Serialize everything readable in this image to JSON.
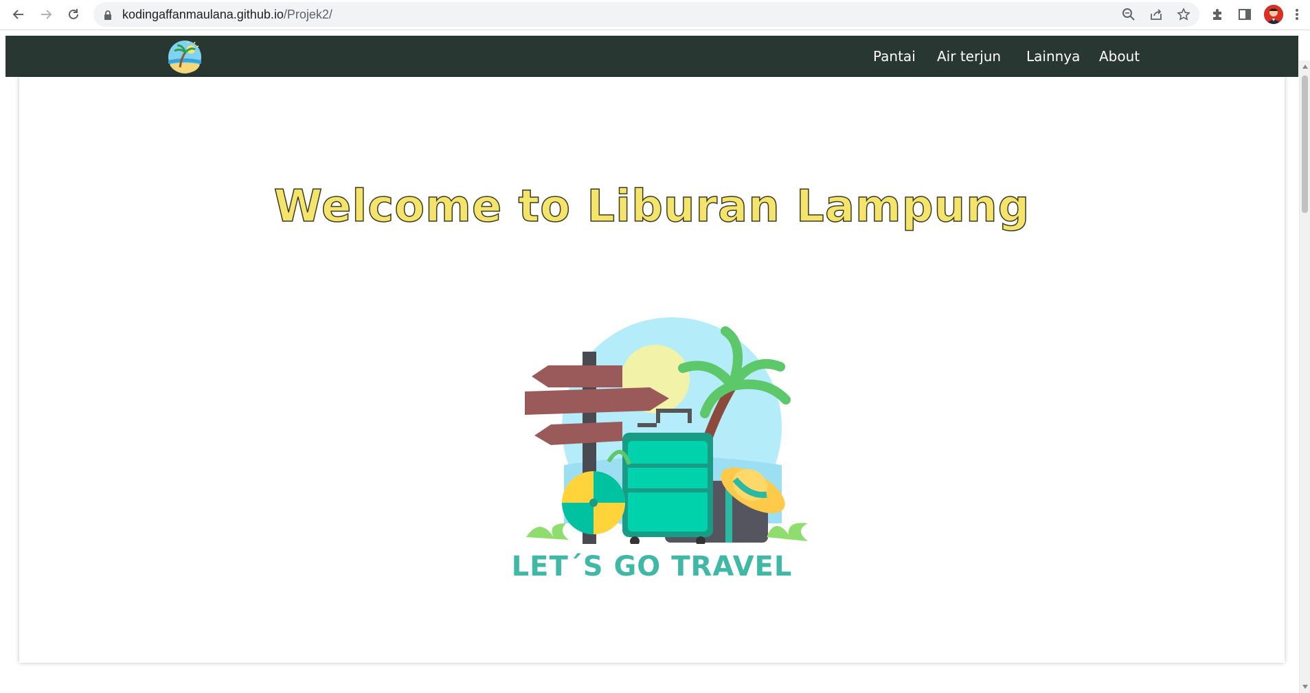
{
  "browser": {
    "url_host": "kodingaffanmaulana.github.io",
    "url_path": "/Projek2/",
    "icons": [
      "back-icon",
      "forward-icon",
      "reload-icon",
      "lock-icon",
      "zoom-icon",
      "share-icon",
      "bookmark-star-icon",
      "extensions-icon",
      "side-panel-icon",
      "profile-avatar",
      "more-menu-icon"
    ]
  },
  "site": {
    "nav": {
      "items": [
        {
          "label": "Pantai"
        },
        {
          "label": "Air terjun"
        },
        {
          "label": "Lainnya"
        },
        {
          "label": "About"
        }
      ],
      "background": "#283731"
    },
    "hero": {
      "title": "Welcome to Liburan Lampung",
      "title_color": "#f4e46c",
      "slogan": "LET´S GO TRAVEL",
      "slogan_color": "#3fb8a6"
    }
  }
}
